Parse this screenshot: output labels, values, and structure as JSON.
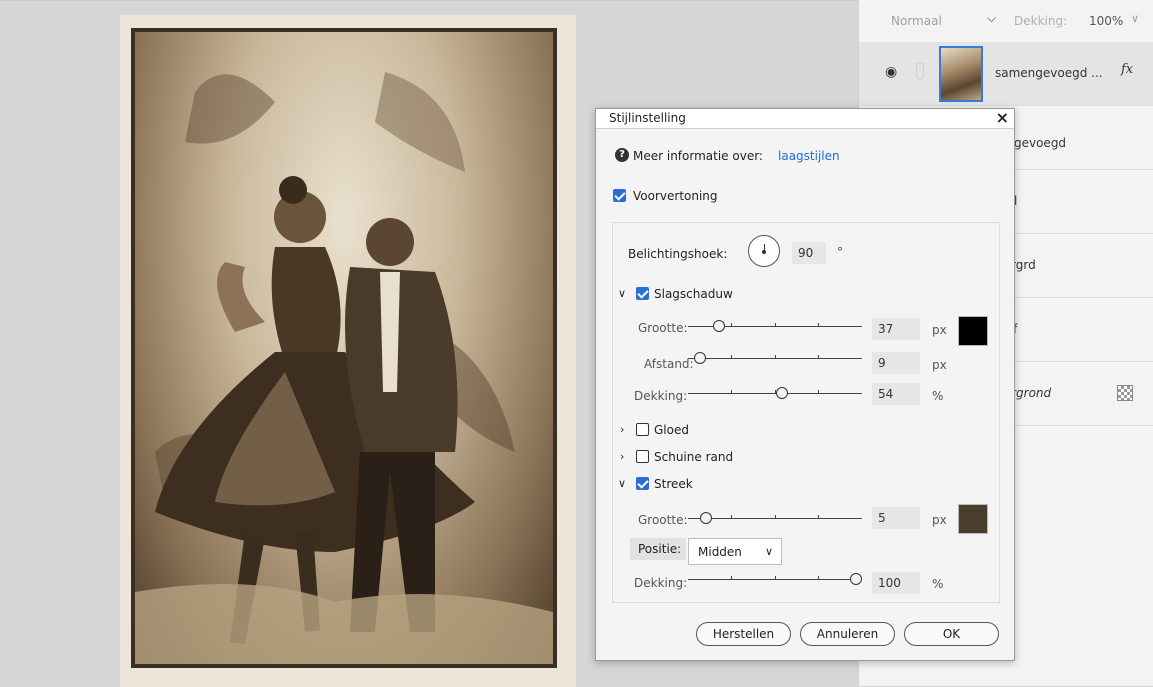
{
  "layers_header": {
    "blend_mode": "Normaal",
    "opacity_label": "Dekking:",
    "opacity_value": "100%"
  },
  "layers": [
    {
      "name": "samengevoegd ...",
      "fx": "fx",
      "active": true
    },
    {
      "name": "engevoegd"
    },
    {
      "name": "pel"
    },
    {
      "name": "tergrd"
    },
    {
      "name": "ecf"
    },
    {
      "name": "tergrond",
      "italic": true
    }
  ],
  "dialog": {
    "title": "Stijlinstelling",
    "close": "×",
    "help_text": "Meer informatie over:",
    "help_link": "laagstijlen",
    "preview_label": "Voorvertoning",
    "angle_label": "Belichtingshoek:",
    "angle_value": "90",
    "angle_unit": "°",
    "drop_shadow": {
      "label": "Slagschaduw",
      "size_label": "Grootte:",
      "size_value": "37",
      "size_unit": "px",
      "distance_label": "Afstand:",
      "distance_value": "9",
      "distance_unit": "px",
      "opacity_label": "Dekking:",
      "opacity_value": "54",
      "opacity_unit": "%",
      "color": "#000000"
    },
    "glow_label": "Gloed",
    "bevel_label": "Schuine rand",
    "stroke": {
      "label": "Streek",
      "size_label": "Grootte:",
      "size_value": "5",
      "size_unit": "px",
      "position_label": "Positie:",
      "position_value": "Midden",
      "opacity_label": "Dekking:",
      "opacity_value": "100",
      "opacity_unit": "%",
      "color": "#4a3d2b"
    },
    "buttons": {
      "reset": "Herstellen",
      "cancel": "Annuleren",
      "ok": "OK"
    }
  }
}
